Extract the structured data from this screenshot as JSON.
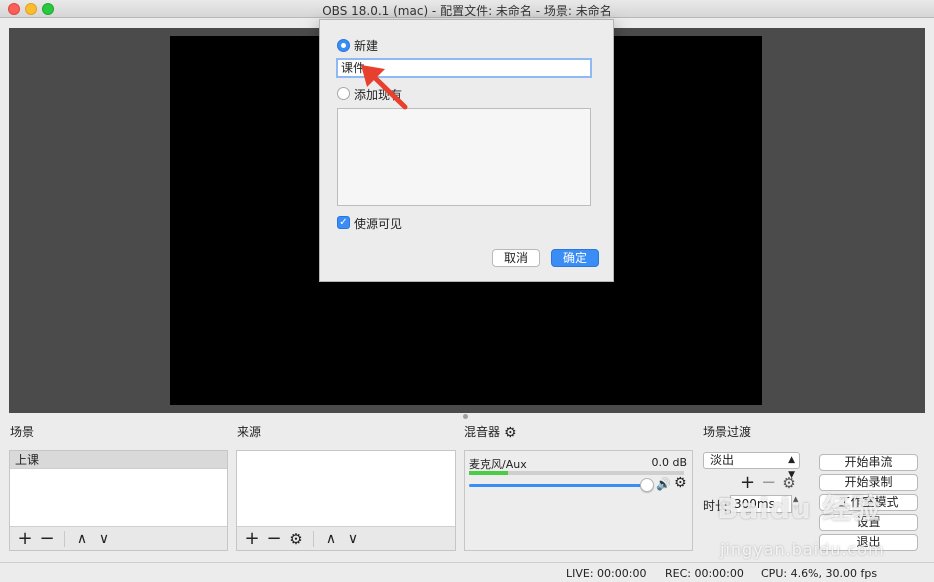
{
  "window": {
    "title": "OBS 18.0.1 (mac) - 配置文件: 未命名 - 场景: 未命名"
  },
  "dialog": {
    "new_label": "新建",
    "name_value": "课件",
    "add_existing_label": "添加现有",
    "visible_label": "使源可见",
    "cancel_label": "取消",
    "ok_label": "确定"
  },
  "docks": {
    "scenes_label": "场景",
    "sources_label": "来源",
    "mixer_label": "混音器",
    "transitions_label": "场景过渡"
  },
  "scenes": {
    "items": [
      {
        "label": "上课"
      }
    ]
  },
  "toolbar_glyphs": {
    "add": "+",
    "remove": "−",
    "up": "∧",
    "down": "∨",
    "gear": "⚙"
  },
  "mixer": {
    "channel_name": "麦克风/Aux",
    "volume_db": "0.0 dB",
    "volume_fraction": 1.0,
    "meter_fraction": 0.18
  },
  "transitions": {
    "selected": "淡出",
    "duration_label": "时长",
    "duration_value": "300ms"
  },
  "controls": {
    "start_streaming": "开始串流",
    "start_recording": "开始录制",
    "studio_mode": "工作室模式",
    "settings": "设置",
    "exit": "退出"
  },
  "status": {
    "live": "LIVE: 00:00:00",
    "rec": "REC: 00:00:00",
    "cpu": "CPU: 4.6%, 30.00 fps"
  },
  "watermark": {
    "logo": "Baidu 经验",
    "url": "jingyan.baidu.com"
  },
  "colors": {
    "accent": "#3b8df6",
    "annotation": "#e8402f",
    "meter": "#4bcc46"
  }
}
